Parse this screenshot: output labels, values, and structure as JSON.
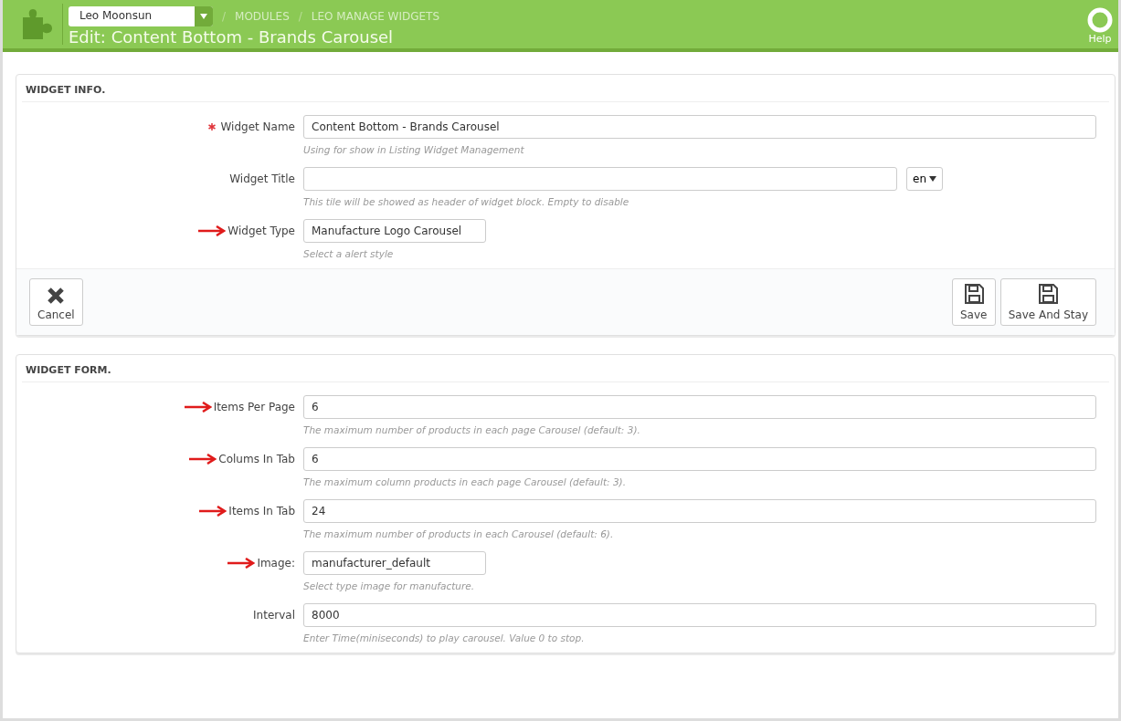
{
  "header": {
    "shop": "Leo Moonsun",
    "separator": "/",
    "breadcrumbs": [
      "MODULES",
      "LEO MANAGE WIDGETS"
    ],
    "title": "Edit: Content Bottom - Brands Carousel",
    "help": "Help"
  },
  "panels": [
    {
      "title": "WIDGET INFO.",
      "fields": [
        {
          "kind": "text",
          "label": "Widget Name",
          "required": true,
          "arrow": false,
          "value": "Content Bottom - Brands Carousel",
          "help": "Using for show in Listing Widget Management"
        },
        {
          "kind": "lang",
          "label": "Widget Title",
          "required": false,
          "arrow": false,
          "lang": "en",
          "help": "This tile will be showed as header of widget block. Empty to disable"
        },
        {
          "kind": "short",
          "label": "Widget Type",
          "required": false,
          "arrow": true,
          "value": "Manufacture Logo Carousel",
          "help": "Select a alert style"
        }
      ],
      "footer": {
        "cancel": "Cancel",
        "buttons": [
          "Save",
          "Save And Stay"
        ]
      }
    },
    {
      "title": "WIDGET FORM.",
      "fields": [
        {
          "kind": "text",
          "label": "Items Per Page",
          "required": false,
          "arrow": true,
          "value": "6",
          "help": "The maximum number of products in each page Carousel (default: 3)."
        },
        {
          "kind": "text",
          "label": "Colums In Tab",
          "required": false,
          "arrow": true,
          "value": "6",
          "help": "The maximum column products in each page Carousel (default: 3)."
        },
        {
          "kind": "text",
          "label": "Items In Tab",
          "required": false,
          "arrow": true,
          "value": "24",
          "help": "The maximum number of products in each Carousel (default: 6)."
        },
        {
          "kind": "short",
          "label": "Image:",
          "required": false,
          "arrow": true,
          "value": "manufacturer_default",
          "help": "Select type image for manufacture."
        },
        {
          "kind": "text",
          "label": "Interval",
          "required": false,
          "arrow": false,
          "value": "8000",
          "help": "Enter Time(miniseconds) to play carousel. Value 0 to stop."
        }
      ]
    }
  ]
}
